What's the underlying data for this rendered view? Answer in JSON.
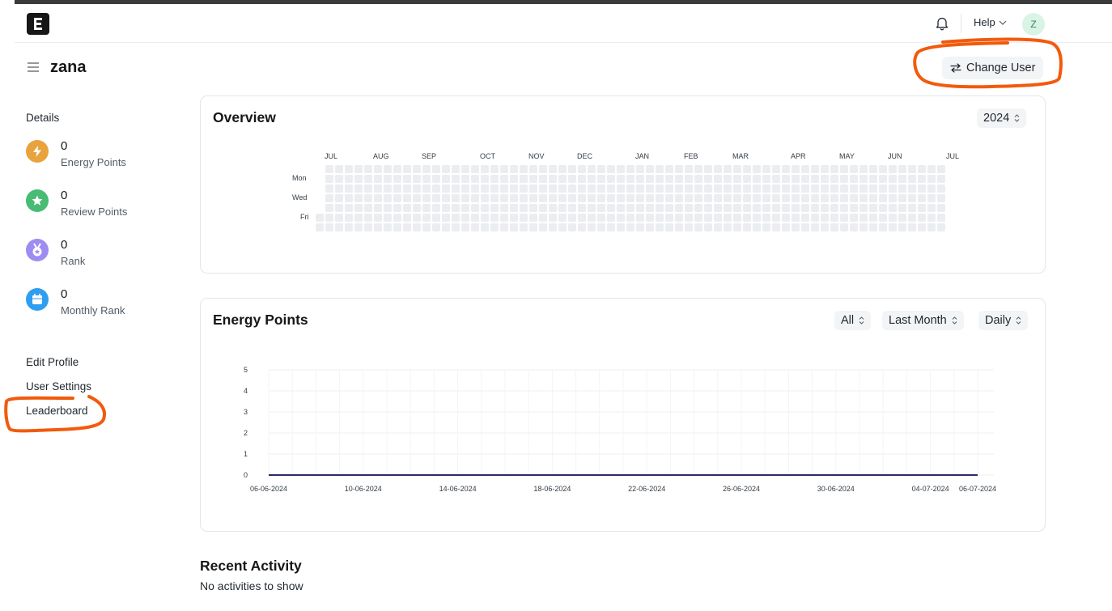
{
  "app": {
    "logo_letter": "E"
  },
  "navbar": {
    "help_label": "Help",
    "avatar_letter": "Z"
  },
  "page": {
    "title": "zana",
    "change_user_label": "Change User"
  },
  "sidebar": {
    "heading": "Details",
    "stats": [
      {
        "value": "0",
        "label": "Energy Points",
        "icon": "bolt-icon",
        "color": "#e8a33d"
      },
      {
        "value": "0",
        "label": "Review Points",
        "icon": "star-icon",
        "color": "#48bb74"
      },
      {
        "value": "0",
        "label": "Rank",
        "icon": "medal-icon",
        "color": "#9f8cf0"
      },
      {
        "value": "0",
        "label": "Monthly Rank",
        "icon": "calendar-icon",
        "color": "#2f9ef0"
      }
    ],
    "links": [
      "Edit Profile",
      "User Settings",
      "Leaderboard"
    ]
  },
  "overview": {
    "title": "Overview",
    "year": "2024",
    "months": [
      "JUL",
      "AUG",
      "SEP",
      "OCT",
      "NOV",
      "DEC",
      "JAN",
      "FEB",
      "MAR",
      "APR",
      "MAY",
      "JUN",
      "JUL"
    ],
    "days": [
      "Mon",
      "Wed",
      "Fri"
    ]
  },
  "energy": {
    "title": "Energy Points",
    "filter_type": "All",
    "filter_range": "Last Month",
    "filter_interval": "Daily"
  },
  "chart_data": {
    "type": "line",
    "title": "",
    "xlabel": "",
    "ylabel": "",
    "x_tick_labels": [
      "06-06-2024",
      "10-06-2024",
      "14-06-2024",
      "18-06-2024",
      "22-06-2024",
      "26-06-2024",
      "30-06-2024",
      "04-07-2024",
      "06-07-2024"
    ],
    "y_ticks": [
      "0",
      "1",
      "2",
      "3",
      "4",
      "5"
    ],
    "ylim": [
      0,
      5
    ],
    "x_range": [
      "06-06-2024",
      "06-07-2024"
    ],
    "series": [
      {
        "values": [
          0,
          0
        ]
      }
    ],
    "line_color": "#2d2a6b",
    "grid": true
  },
  "recent": {
    "title": "Recent Activity",
    "empty_text": "No activities to show"
  },
  "colors": {
    "accent_mark": "#f25a0c",
    "heat_empty": "#ebedf0"
  }
}
